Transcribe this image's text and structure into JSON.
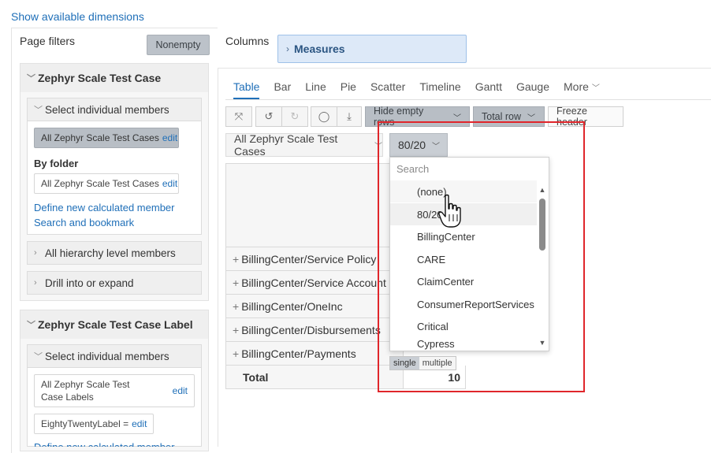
{
  "top_link": "Show available dimensions",
  "page_filters": {
    "title": "Page filters",
    "nonempty_label": "Nonempty",
    "sections": [
      {
        "title": "Zephyr Scale Test Case",
        "select_members": "Select individual members",
        "selected_chip": "All Zephyr Scale Test Cases",
        "edit": "edit",
        "by_folder_label": "By folder",
        "folder_chip": "All Zephyr Scale Test Cases",
        "define_link": "Define new calculated member",
        "search_link": "Search and bookmark",
        "all_hierarchy": "All hierarchy level members",
        "drill": "Drill into or expand"
      },
      {
        "title": "Zephyr Scale Test Case Label",
        "select_members": "Select individual members",
        "selected_chip": "All Zephyr Scale Test Case Labels",
        "edit": "edit",
        "second_chip": "EightyTwentyLabel =",
        "cut_text": "Define new calculated member"
      }
    ]
  },
  "columns": {
    "title": "Columns",
    "measures": "Measures"
  },
  "tabs": [
    "Table",
    "Bar",
    "Line",
    "Pie",
    "Scatter",
    "Timeline",
    "Gantt",
    "Gauge",
    "More"
  ],
  "toolbar": {
    "hide_empty_rows": "Hide empty rows",
    "total_row": "Total row",
    "freeze_header": "Freeze header"
  },
  "filters": {
    "test_cases": "All Zephyr Scale Test Cases",
    "label_filter": "80/20"
  },
  "rows": [
    {
      "label": "BillingCenter/Service Policy"
    },
    {
      "label": "BillingCenter/Service Account"
    },
    {
      "label": "BillingCenter/OneInc"
    },
    {
      "label": "BillingCenter/Disbursements"
    },
    {
      "label": "BillingCenter/Payments"
    }
  ],
  "total": {
    "label": "Total",
    "value": "10"
  },
  "dropdown": {
    "search_placeholder": "Search",
    "items": [
      "(none)",
      "80/20",
      "BillingCenter",
      "CARE",
      "ClaimCenter",
      "ConsumerReportServices",
      "Critical",
      "Cypress"
    ],
    "single": "single",
    "multiple": "multiple"
  },
  "colors": {
    "accent": "#1f6fb8",
    "highlight_border": "#e0262b",
    "measures_bg": "#dde9f8"
  }
}
